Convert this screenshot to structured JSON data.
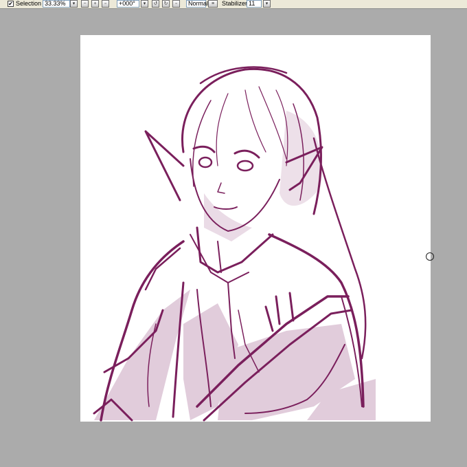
{
  "toolbar": {
    "selection_label": "Selection",
    "selection_checked": true,
    "zoom": "33.33%",
    "rotation": "+000°",
    "blend_mode": "Normal",
    "stabilizer_label": "Stabilizer",
    "stabilizer_value": "11",
    "icons": {
      "zoom_dropdown": "chevron-down-icon",
      "zoom_out": "zoom-out-icon",
      "zoom_in": "zoom-in-icon",
      "zoom_fit": "fit-window-icon",
      "rotate_dropdown": "chevron-down-icon",
      "rotate_left": "rotate-left-icon",
      "rotate_right": "rotate-right-icon",
      "rotate_reset": "rotate-reset-icon",
      "blend_toggle": "blend-mode-icon",
      "stabilizer_dropdown": "chevron-down-icon"
    }
  },
  "canvas": {
    "background_color": "#ffffff",
    "workspace_color": "#ababab",
    "ink_color": "#7a1f5c",
    "shade_color": "#c9a2bd",
    "artwork": "brush-cursor"
  },
  "colors": {
    "toolbar_bg": "#ece9d8",
    "accent": "#7a1f5c"
  }
}
